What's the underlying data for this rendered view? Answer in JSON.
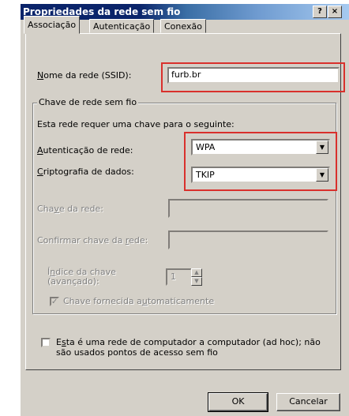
{
  "window": {
    "title": "Propriedades da rede sem fio",
    "help_label": "?",
    "close_label": "×"
  },
  "tabs": [
    {
      "label": "Associação",
      "active": true
    },
    {
      "label": "Autenticação",
      "active": false
    },
    {
      "label": "Conexão",
      "active": false
    }
  ],
  "ssid": {
    "label_prefix": "",
    "label_underline": "N",
    "label_rest": "ome da rede (SSID):",
    "value": "furb.br"
  },
  "key_group": {
    "legend": "Chave de rede sem fio",
    "intro": "Esta rede requer uma chave para o seguinte:",
    "auth": {
      "label_underline": "A",
      "label_rest": "utenticação de rede:",
      "value": "WPA"
    },
    "crypto": {
      "label_underline": "C",
      "label_rest": "riptografia de dados:",
      "value": "TKIP"
    },
    "network_key": {
      "label_a": "Cha",
      "label_u": "v",
      "label_b": "e da rede:",
      "value": ""
    },
    "confirm_key": {
      "label_a": "Confirmar chave da ",
      "label_u": "r",
      "label_b": "ede:",
      "value": ""
    },
    "key_index": {
      "label_line1_a": "Í",
      "label_line1_u": "n",
      "label_line1_b": "dice da chave",
      "label_line2": "(avançado):",
      "value": "1"
    },
    "auto_key": {
      "checked": true,
      "label_a": "Chave fornecida a",
      "label_u": "u",
      "label_b": "tomaticamente"
    }
  },
  "adhoc": {
    "checked": false,
    "line1_a": "E",
    "line1_u": "s",
    "line1_b": "ta é uma rede de computador a computador (ad hoc); não",
    "line2": "são usados pontos de acesso sem fio"
  },
  "buttons": {
    "ok": "OK",
    "cancel": "Cancelar"
  },
  "colors": {
    "highlight_box": "#d9302c",
    "title_bar": "#0a246a",
    "dialog_face": "#d4d0c8"
  }
}
